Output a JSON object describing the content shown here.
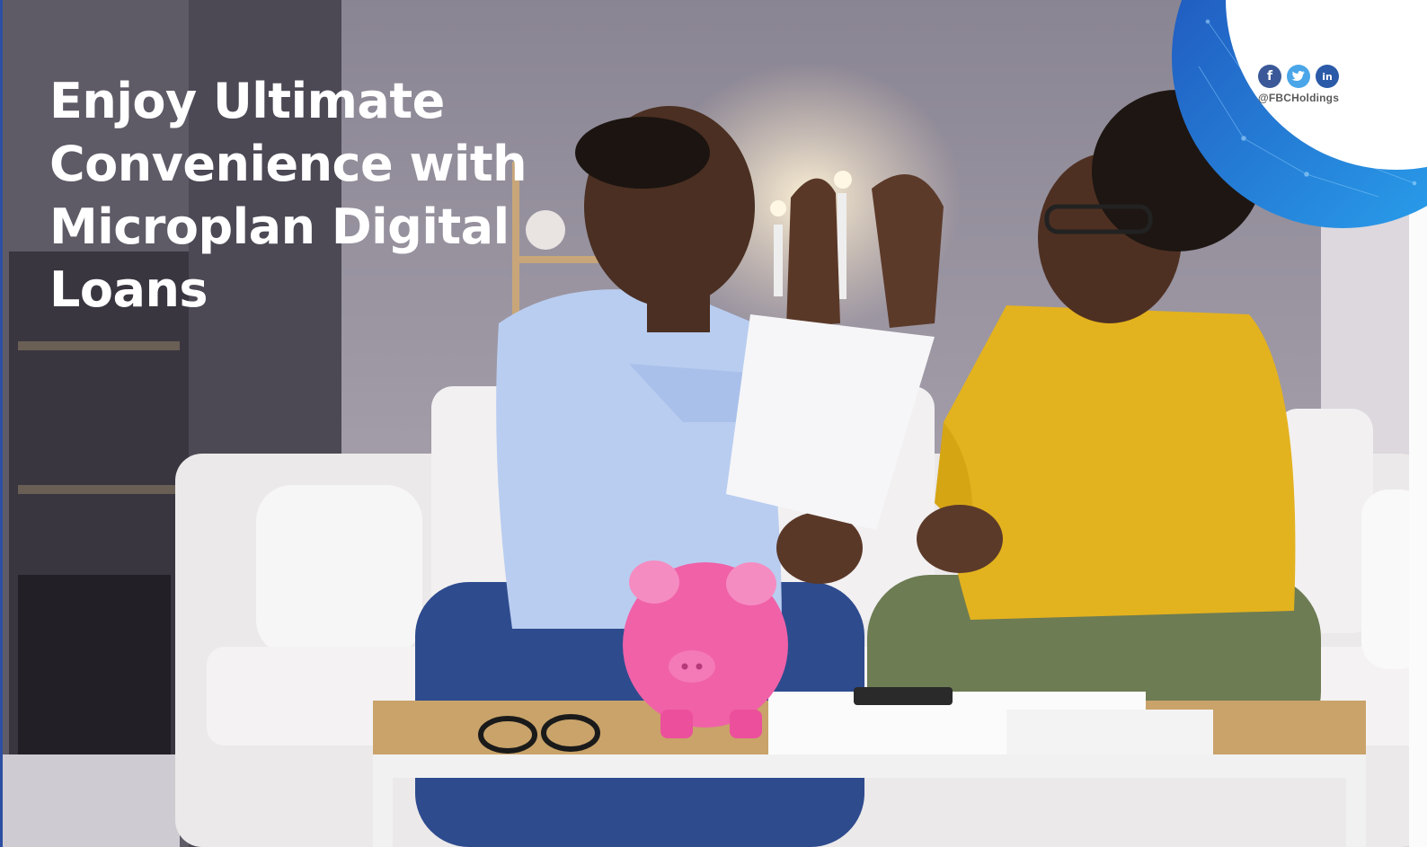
{
  "headline": {
    "lines": [
      "Enjoy Ultimate",
      "Convenience with",
      "Microplan Digital",
      "Loans"
    ]
  },
  "social": {
    "icons": [
      "facebook-icon",
      "twitter-icon",
      "linkedin-icon"
    ],
    "facebook_glyph": "f",
    "linkedin_glyph": "in",
    "handle": "@FBCHoldings"
  },
  "colors": {
    "brand_blue": "#1f4fb8",
    "accent_blue": "#2aa6f0",
    "headline_text": "#ffffff"
  }
}
